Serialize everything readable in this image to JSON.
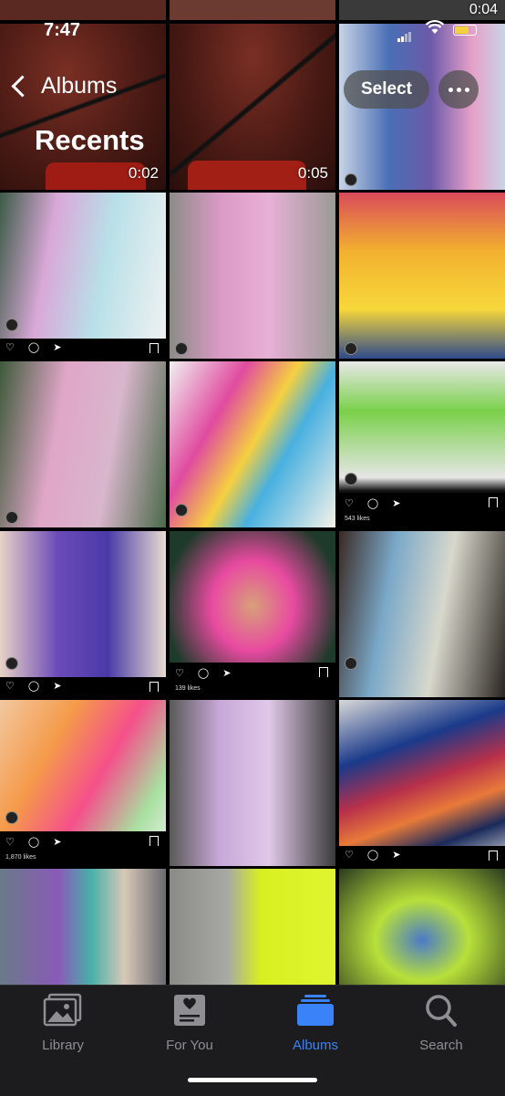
{
  "status_bar": {
    "time": "7:47"
  },
  "nav": {
    "back_label": "Albums",
    "title": "Recents",
    "select_label": "Select"
  },
  "top_strip": {
    "duration": "0:04"
  },
  "videos": [
    {
      "duration": "0:02"
    },
    {
      "duration": "0:05"
    }
  ],
  "likes": {
    "row3_right": "543 likes",
    "row4_mid": "139 likes",
    "row5_left": "1,870 likes"
  },
  "tabs": [
    {
      "label": "Library"
    },
    {
      "label": "For You"
    },
    {
      "label": "Albums"
    },
    {
      "label": "Search"
    }
  ],
  "colors": {
    "accent": "#3a82f7",
    "inactive": "#8e8e93",
    "tabbar_bg": "#1c1c1e"
  },
  "icons": [
    "chevron-left-icon",
    "more-icon",
    "library-icon",
    "for-you-icon",
    "albums-icon",
    "search-icon",
    "heart-icon",
    "comment-icon",
    "send-icon",
    "bookmark-icon"
  ]
}
